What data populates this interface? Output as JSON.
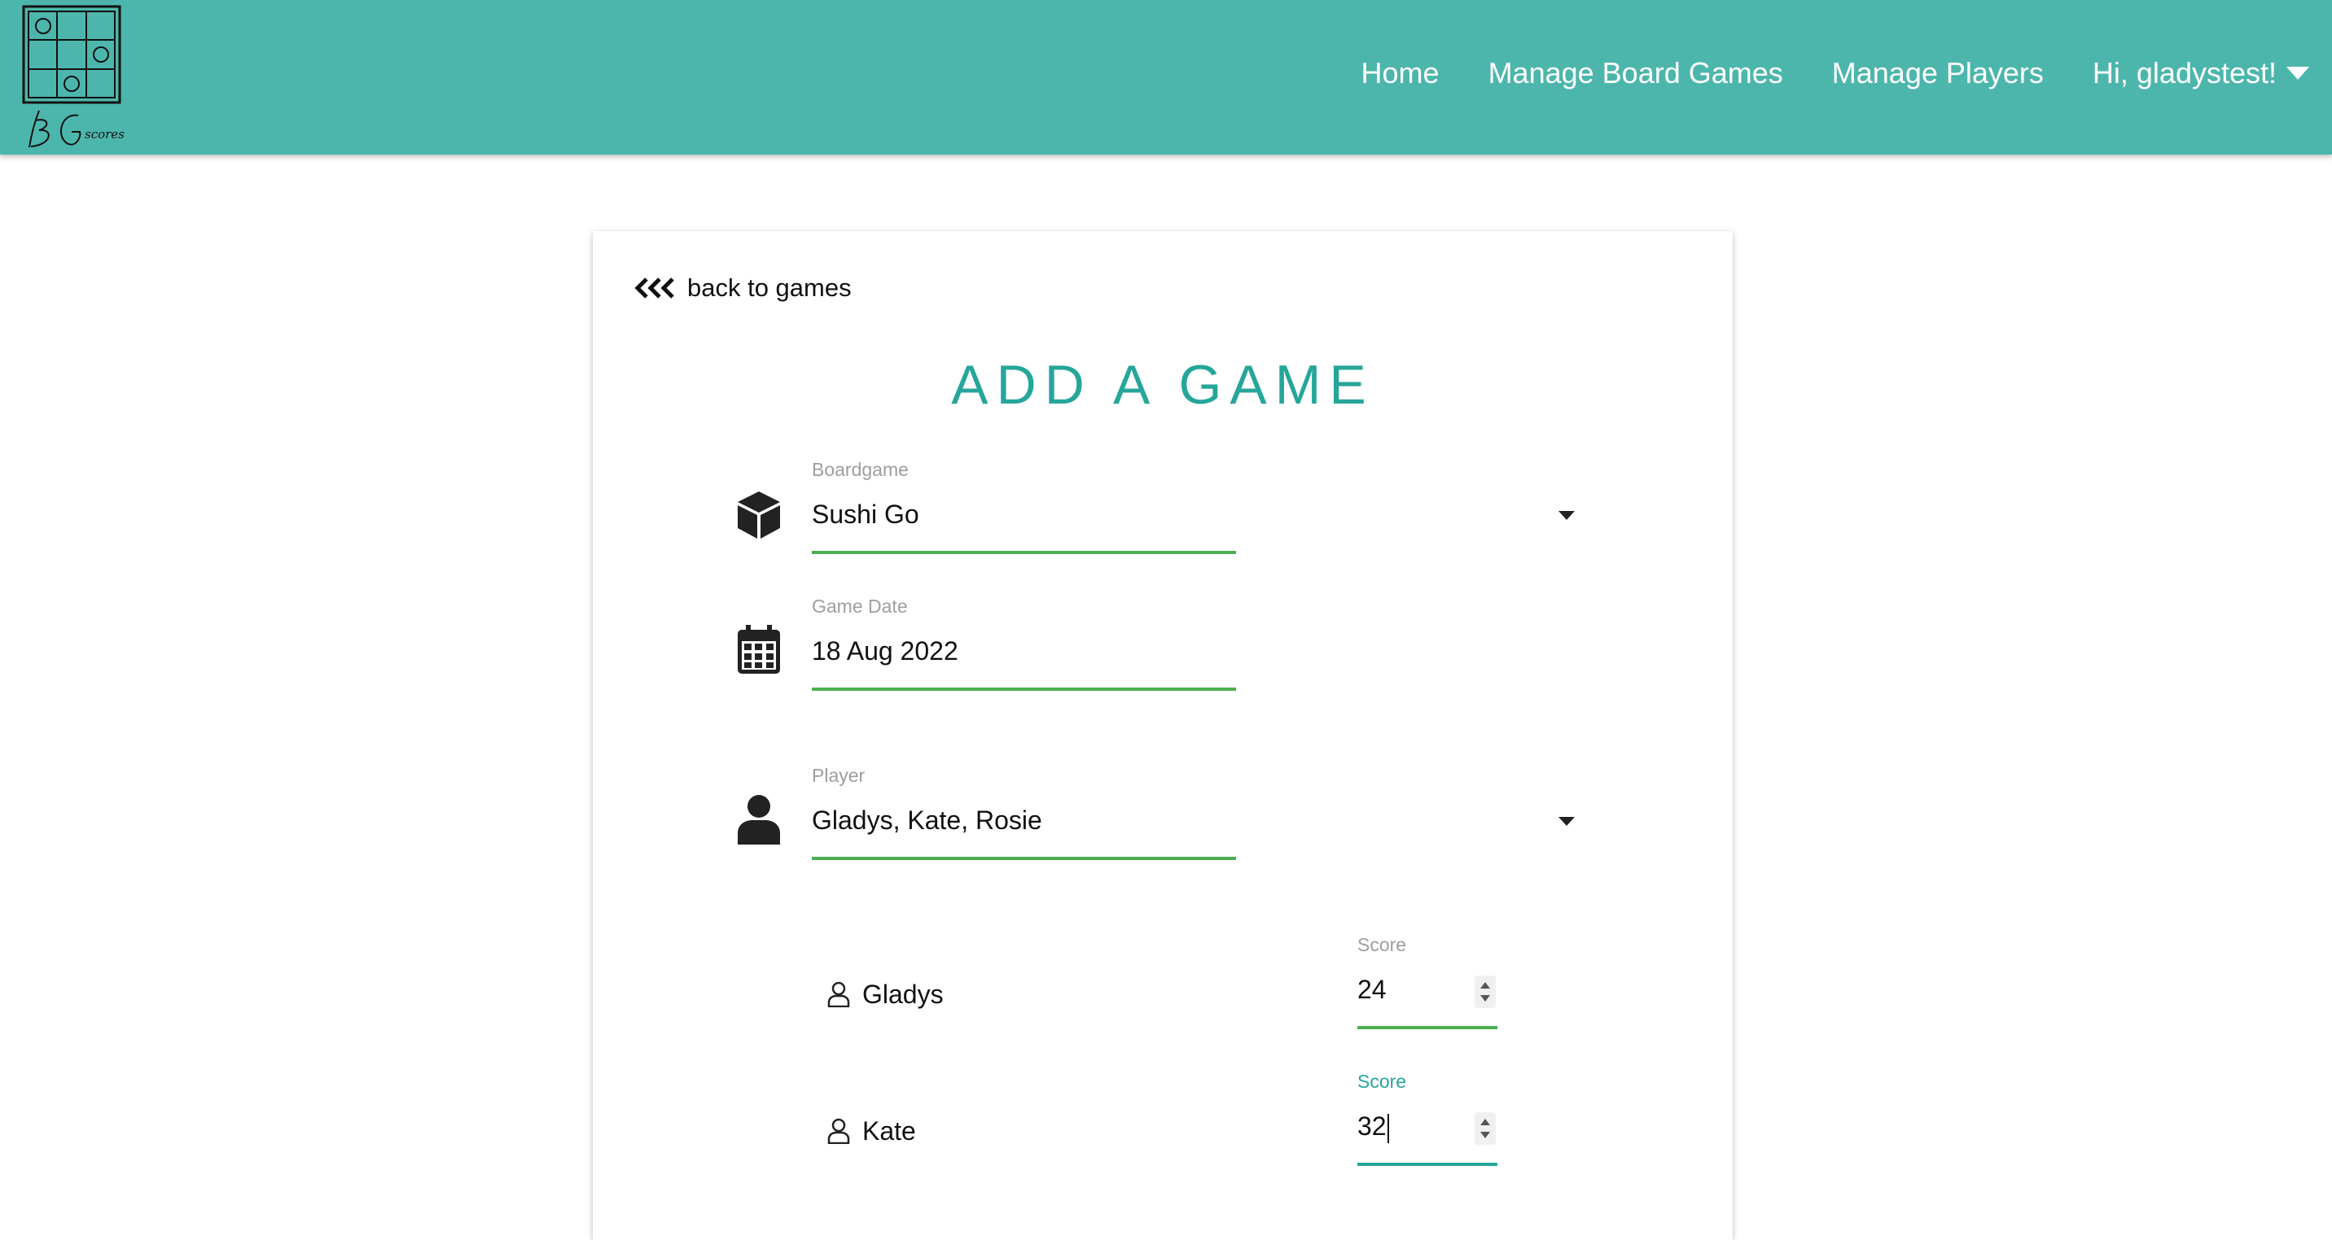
{
  "nav": {
    "logo_text": "BG scores",
    "links": [
      "Home",
      "Manage Board Games",
      "Manage Players",
      "Hi, gladystest!"
    ]
  },
  "card": {
    "back_label": "back to games",
    "title": "ADD A GAME"
  },
  "form": {
    "boardgame": {
      "label": "Boardgame",
      "value": "Sushi Go",
      "icon": "cube-icon"
    },
    "game_date": {
      "label": "Game Date",
      "value": "18 Aug 2022",
      "icon": "calendar-icon"
    },
    "player": {
      "label": "Player",
      "value": "Gladys, Kate, Rosie",
      "icon": "user-icon"
    }
  },
  "scores": [
    {
      "player": "Gladys",
      "label": "Score",
      "value": "24",
      "focused": false
    },
    {
      "player": "Kate",
      "label": "Score",
      "value": "32",
      "focused": true
    }
  ],
  "colors": {
    "navbar": "#4db6ac",
    "accent": "#26a69a",
    "field_underline": "#4caf50"
  }
}
